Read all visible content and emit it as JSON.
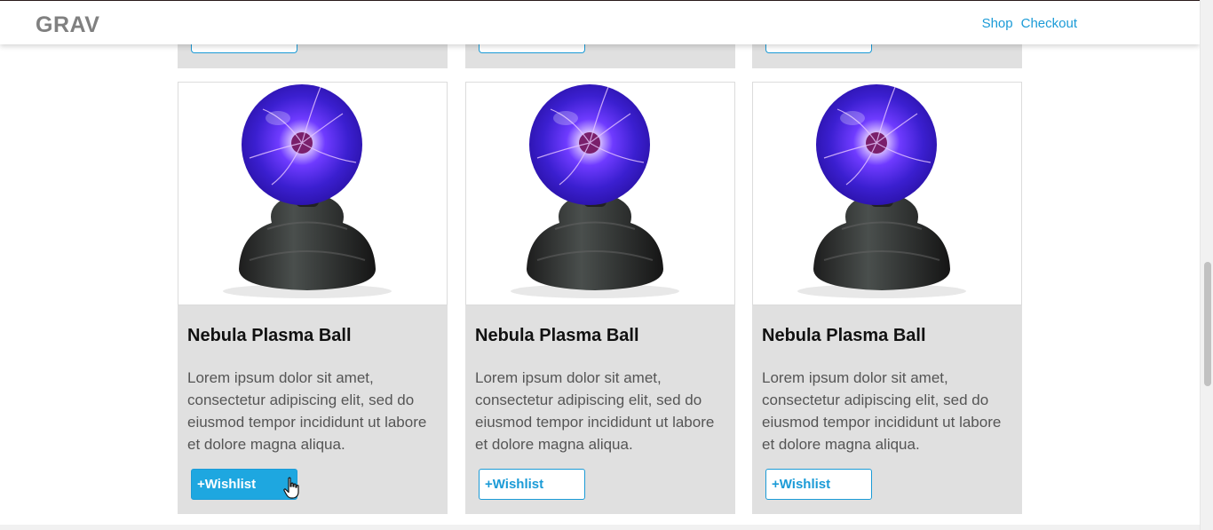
{
  "navbar": {
    "brand": "GRAV",
    "links": [
      "Shop",
      "Checkout"
    ]
  },
  "products": [
    {
      "title": "Nebula Plasma Ball",
      "description": "Lorem ipsum dolor sit amet, consectetur adipiscing elit, sed do eiusmod tempor incididunt ut labore et dolore magna aliqua.",
      "wishlist_label": "+Wishlist",
      "hovered": true
    },
    {
      "title": "Nebula Plasma Ball",
      "description": "Lorem ipsum dolor sit amet, consectetur adipiscing elit, sed do eiusmod tempor incididunt ut labore et dolore magna aliqua.",
      "wishlist_label": "+Wishlist",
      "hovered": false
    },
    {
      "title": "Nebula Plasma Ball",
      "description": "Lorem ipsum dolor sit amet, consectetur adipiscing elit, sed do eiusmod tempor incididunt ut labore et dolore magna aliqua.",
      "wishlist_label": "+Wishlist",
      "hovered": false
    }
  ],
  "colors": {
    "accent": "#1b9bd7",
    "card_bg": "#e0e0e0",
    "brand": "#808080"
  }
}
